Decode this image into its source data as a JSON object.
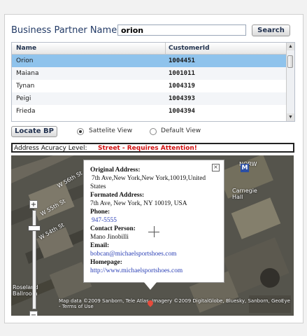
{
  "header": {
    "title": "Business Partner Name"
  },
  "search": {
    "value": "orion",
    "button_label": "Search"
  },
  "table": {
    "columns": [
      "Name",
      "CustomerId"
    ],
    "rows": [
      {
        "name": "Orion",
        "id": "1004451"
      },
      {
        "name": "Maiana",
        "id": "1001011"
      },
      {
        "name": "Tynan",
        "id": "1004319"
      },
      {
        "name": "Peigi",
        "id": "1004393"
      },
      {
        "name": "Frieda",
        "id": "1004394"
      }
    ],
    "selected_index": 0
  },
  "controls": {
    "locate_label": "Locate BP",
    "view_options": [
      "Sattelite View",
      "Default View"
    ],
    "selected_view": "Sattelite View"
  },
  "accuracy": {
    "label": "Address Acuracy Level:",
    "value": "Street - Requires Attention!"
  },
  "popup": {
    "original_heading": "Original Address:",
    "original_line1": "7th Ave,New York,New York,10019,United",
    "original_line2": "States",
    "formatted_heading": "Formated Address:",
    "formatted_value": "7th Ave, New York, NY 10019, USA",
    "phone_heading": "Phone:",
    "phone_value": "947-5555",
    "contact_heading": "Contact Person:",
    "contact_value": "Mano Jinobilli",
    "email_heading": "Email:",
    "email_value": "bobcan@michaelsportshoes.com",
    "homepage_heading": "Homepage:",
    "homepage_value": "http://www.michaelsportshoes.com",
    "close_glyph": "×"
  },
  "map": {
    "labels": {
      "street1": "W 55th St",
      "street2": "W 56th St",
      "street3": "W 54th St",
      "hall": "Carnegie Hall",
      "norw": "NORW",
      "m_badge": "M",
      "roseland": "Roseland Ballroom",
      "attribution": "Map data ©2009 Sanborn, Tele Atlas, Imagery ©2009 DigitalGlobe, Bluesky, Sanborn, GeoEye - Terms of Use"
    },
    "zoom_in": "+",
    "zoom_out": "−",
    "slider_level": 0.7
  }
}
